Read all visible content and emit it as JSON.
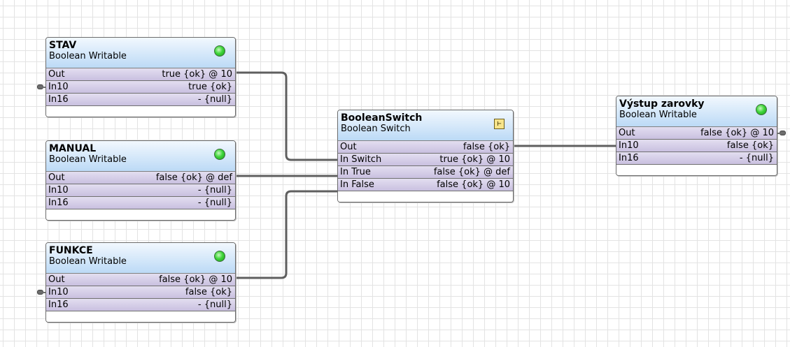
{
  "blocks": {
    "stav": {
      "title": "STAV",
      "subtitle": "Boolean Writable",
      "status_icon": "green-status-dot",
      "slots": [
        {
          "name": "Out",
          "value": "true {ok} @ 10"
        },
        {
          "name": "In10",
          "value": "true {ok}"
        },
        {
          "name": "In16",
          "value": "- {null}"
        }
      ]
    },
    "manual": {
      "title": "MANUAL",
      "subtitle": "Boolean Writable",
      "status_icon": "green-status-dot",
      "slots": [
        {
          "name": "Out",
          "value": "false {ok} @ def"
        },
        {
          "name": "In10",
          "value": "- {null}"
        },
        {
          "name": "In16",
          "value": "- {null}"
        }
      ]
    },
    "funkce": {
      "title": "FUNKCE",
      "subtitle": "Boolean Writable",
      "status_icon": "green-status-dot",
      "slots": [
        {
          "name": "Out",
          "value": "false {ok} @ 10"
        },
        {
          "name": "In10",
          "value": "false {ok}"
        },
        {
          "name": "In16",
          "value": "- {null}"
        }
      ]
    },
    "switch": {
      "title": "BooleanSwitch",
      "subtitle": "Boolean Switch",
      "status_icon": "switch-icon",
      "slots": [
        {
          "name": "Out",
          "value": "false {ok}"
        },
        {
          "name": "In Switch",
          "value": "true {ok} @ 10"
        },
        {
          "name": "In True",
          "value": "false {ok} @ def"
        },
        {
          "name": "In False",
          "value": "false {ok} @ 10"
        }
      ]
    },
    "vystup": {
      "title": "Výstup zarovky",
      "subtitle": "Boolean Writable",
      "status_icon": "green-status-dot",
      "slots": [
        {
          "name": "Out",
          "value": "false {ok} @ 10"
        },
        {
          "name": "In10",
          "value": "false {ok}"
        },
        {
          "name": "In16",
          "value": "- {null}"
        }
      ]
    }
  },
  "links": [
    {
      "from": "STAV.Out",
      "to": "BooleanSwitch.In Switch"
    },
    {
      "from": "MANUAL.Out",
      "to": "BooleanSwitch.In True"
    },
    {
      "from": "FUNKCE.Out",
      "to": "BooleanSwitch.In False"
    },
    {
      "from": "BooleanSwitch.Out",
      "to": "Výstup zarovky.In10"
    }
  ],
  "colors": {
    "header_top": "#f2f8fe",
    "header_bottom": "#bcdaf6",
    "slot_top": "#e3def0",
    "slot_bottom": "#c9c0e0",
    "wire": "#5f5f5f",
    "status_green": "#3fd63a",
    "grid": "#e3e3e3"
  }
}
